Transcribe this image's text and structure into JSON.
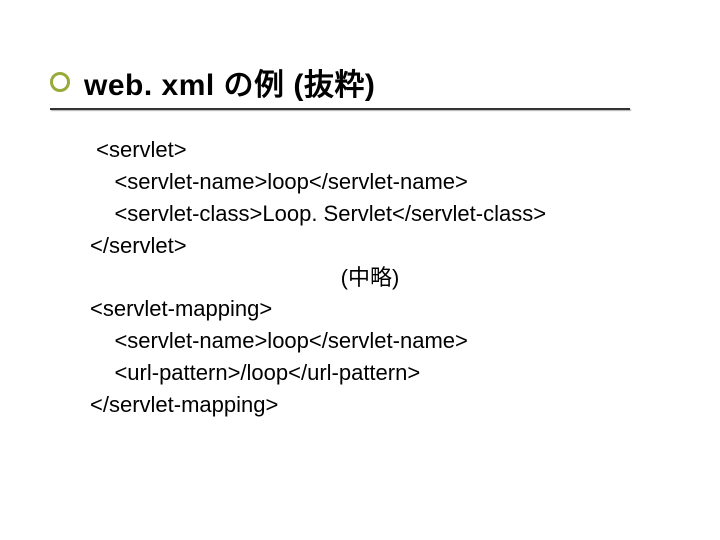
{
  "title": "web. xml の例 (抜粋)",
  "code": {
    "line1": " <servlet>",
    "line2": "    <servlet-name>loop</servlet-name>",
    "line3": "    <servlet-class>Loop. Servlet</servlet-class>",
    "line4": "</servlet>",
    "omit": "(中略)",
    "line5": "<servlet-mapping>",
    "line6": "    <servlet-name>loop</servlet-name>",
    "line7": "    <url-pattern>/loop</url-pattern>",
    "line8": "</servlet-mapping>"
  }
}
